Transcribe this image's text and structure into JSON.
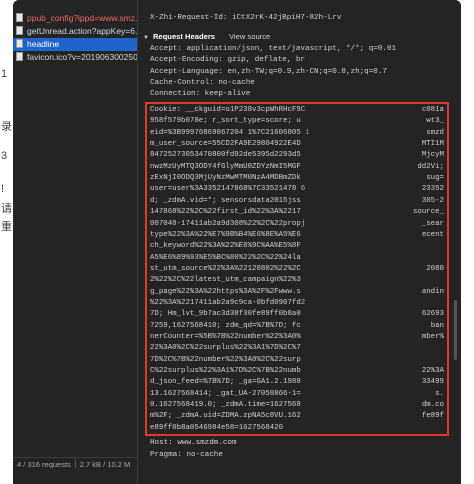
{
  "left_edge": [
    "1",
    "录",
    "3",
    "!",
    "请",
    "重"
  ],
  "requests": [
    {
      "name": "ppub_config?ippd=www.smz...",
      "state": "error"
    },
    {
      "name": "getUnread.action?appKey=6...",
      "state": "normal"
    },
    {
      "name": "headline",
      "state": "selected"
    },
    {
      "name": "favicon.ico?v=201906300250",
      "state": "normal"
    }
  ],
  "status": {
    "requests": "4 / 316 requests",
    "transferred": "2.7 kB / 10.2 M"
  },
  "detail": {
    "request_id": "X-Zhi-Request-Id: iCtX2rK-42jBpiH7-82h-Lrv",
    "section_title": "Request Headers",
    "view_source": "View source",
    "headers_before": [
      "Accept: application/json, text/javascript, */*; q=0.01",
      "Accept-Encoding: gzip, deflate, br",
      "Accept-Language: en,zh-TW;q=0.9,zh-CN;q=0.8,zh;q=0.7",
      "Cache-Control: no-cache",
      "Connection: keep-alive"
    ],
    "cookie_left": [
      "Cookie: __ckguid=o1P238v3cpWhRHcF9C",
      "958f579b078e; r_sort_type=score; u",
      "eid=%3B99976869067204 1%7C21606805 1",
      "m_user_source=55CD2FA9E29804922E4D",
      "84725273053470800fd92de5395d2293d5",
      "nwzMzUyMTQ3ODY4fGlyMmU0ZDYzNmI5MGF",
      "zExNjI0ODQ3MjUyNzMwMTM0NzA4MDBmZDk",
      "user=user%3A3352147868%7C33521478 6",
      "d; _zdmA.vid=*; sensorsdata2015jss",
      "147868%22%2C%22first_id%22%3A%2217",
      "007040-17411ab2a9d308%22%2C%22propj",
      "type%22%3A%22%E7%9B%B4%E6%8E%A5%E6",
      "ch_keyword%22%3A%22%E6%9C%AA%E5%8F",
      "A5%E6%89%93%E5%BC%80%22%2C%22%24la",
      "st_utm_source%22%3A%22120802%22%2C",
      "2%22%2C%22latest_utm_campaign%22%3",
      "g_page%22%3A%22https%3A%2F%2Fwww.s",
      "%22%3A%2217411ab2a9c9ca-0bfd0907fd2",
      "7D; Hm_lvt_9b7ac3d38f30fe89ff0b8a0",
      "7259,1627568410; zdm_qd=%7B%7D; fc",
      "nerCounter=%5B%7B%22number%22%3A0%",
      "22%3A0%2C%22surplus%22%3A1%7D%2C%7",
      "7D%2C%7B%22number%22%3A0%2C%22surp",
      "C%22surplus%22%3A1%7D%2C%7B%22numb",
      "d_json_feed=%7B%7D; _ga=GA1.2.1988",
      "13.1627568414; _gat_UA-27058866-1=",
      "0.1627568419.0; _zdmA.time=1627568",
      "m%2F; _zdmA.uid=ZDMA.zpNA5c8VU.162",
      "e89ff0b8a0546984e58=1627568420"
    ],
    "cookie_right": [
      "c081a",
      "wt3_",
      "smzd",
      "MTI1M",
      "MjcyM",
      "dd2Vi;",
      "sug=",
      "23352",
      "305-2",
      "source_",
      "_sear",
      "ecent",
      "",
      "",
      "2080",
      "",
      "andin",
      "",
      "62693",
      "ban",
      "mber%",
      "",
      "",
      "22%3A",
      "33499",
      "s.",
      "dm.co",
      "fe89f",
      ""
    ],
    "headers_after": [
      "Host: www.smzdm.com",
      "Pragma: no-cache"
    ]
  }
}
